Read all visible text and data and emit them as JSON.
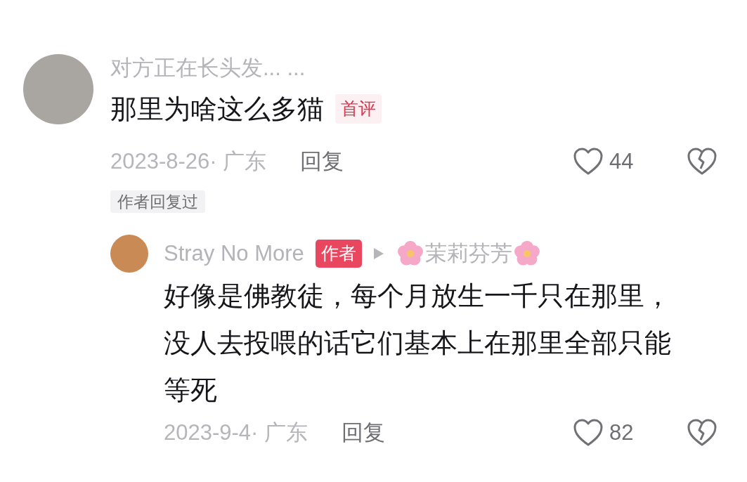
{
  "comments": [
    {
      "user": "对方正在长头发... ...",
      "text": "那里为啥这么多猫",
      "badge": "首评",
      "date": "2023-8-26· 广东",
      "reply_label": "回复",
      "likes": "44",
      "liked": false,
      "tag": "作者回复过",
      "replies": [
        {
          "user": "Stray No More",
          "author_badge": "作者",
          "reply_to": "茉莉芬芳",
          "text": "好像是佛教徒，每个月放生一千只在那里，没人去投喂的话它们基本上在那里全部只能等死",
          "date": "2023-9-4· 广东",
          "reply_label": "回复",
          "likes": "82",
          "liked": false
        }
      ]
    }
  ]
}
